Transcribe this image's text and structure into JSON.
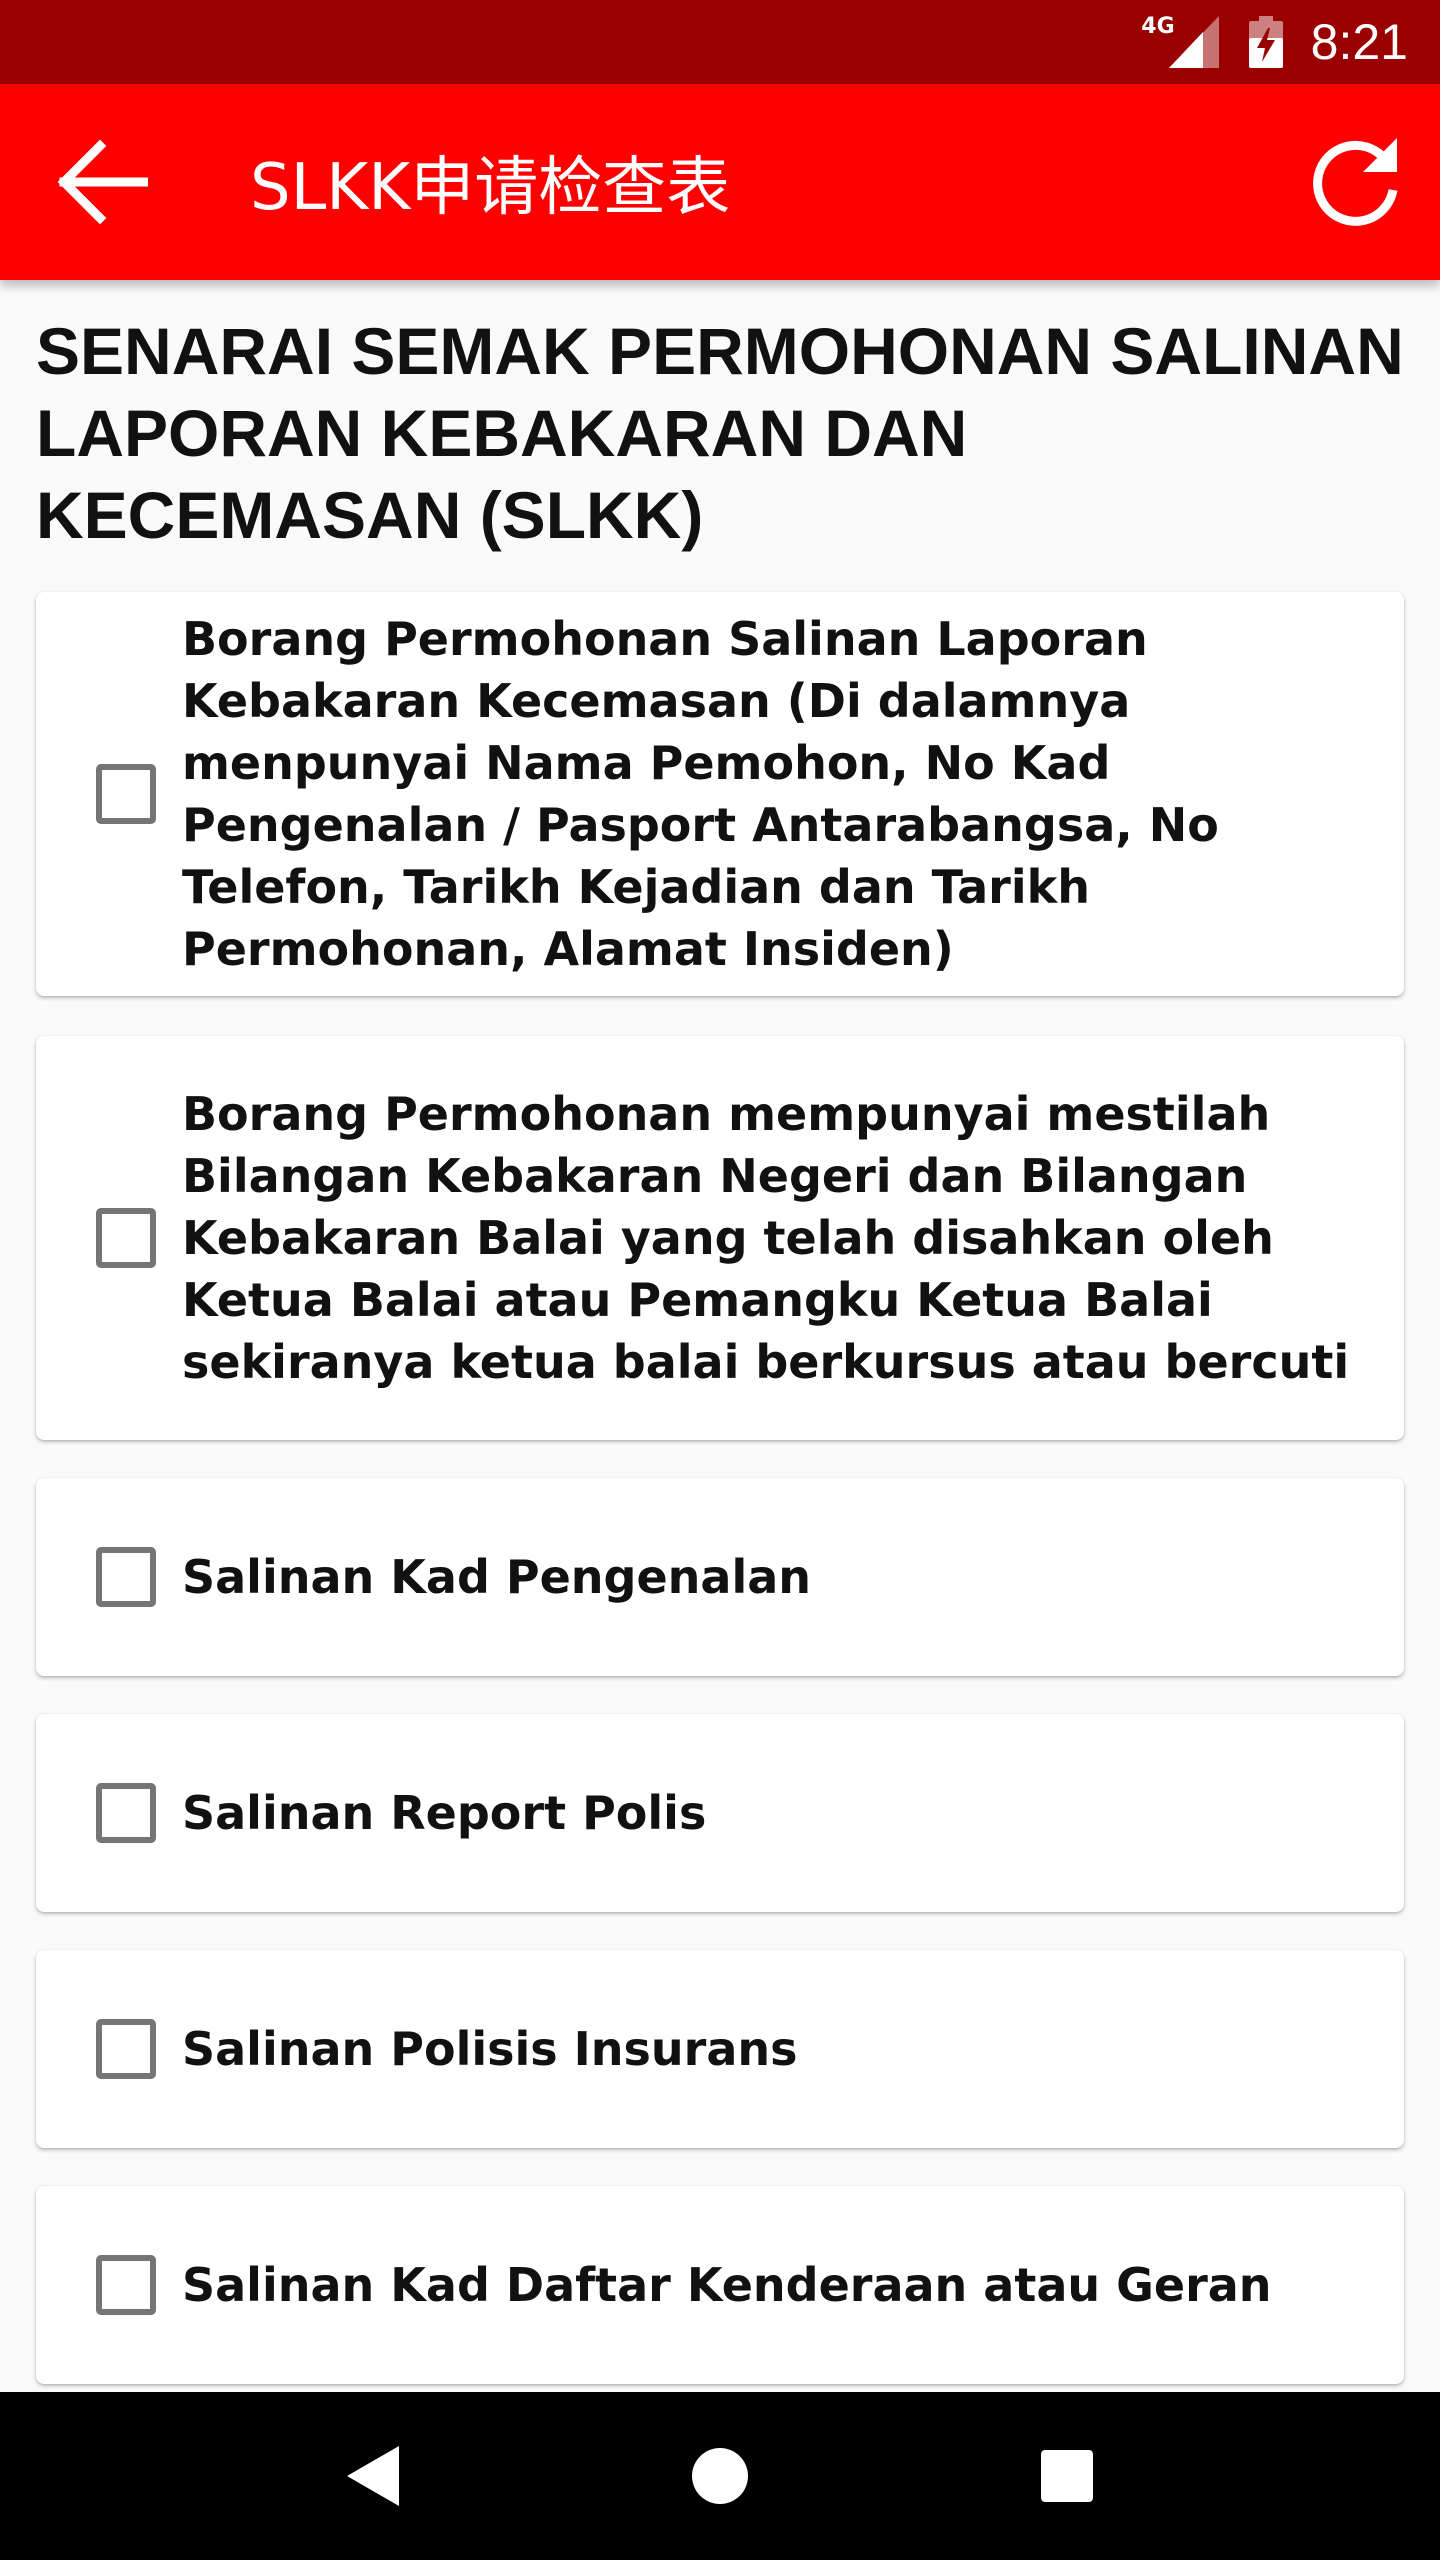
{
  "status_bar": {
    "network": "4G",
    "time": "8:21"
  },
  "app_bar": {
    "title": "SLKK申请检查表",
    "back_icon": "arrow-left-icon",
    "refresh_icon": "refresh-icon"
  },
  "main": {
    "heading": "SENARAI SEMAK PERMOHONAN SALINAN LAPORAN KEBAKARAN DAN KECEMASAN (SLKK)",
    "items": [
      {
        "label": "Borang Permohonan Salinan Laporan Kebakaran Kecemasan (Di dalamnya menpunyai Nama Pemohon, No Kad Pengenalan / Pasport Antarabangsa, No Telefon, Tarikh Kejadian dan Tarikh Permohonan, Alamat Insiden)",
        "checked": false
      },
      {
        "label": "Borang Permohonan mempunyai mestilah Bilangan Kebakaran Negeri dan Bilangan Kebakaran Balai yang telah disahkan oleh Ketua Balai atau Pemangku Ketua Balai sekiranya ketua balai berkursus atau bercuti",
        "checked": false
      },
      {
        "label": "Salinan Kad Pengenalan",
        "checked": false
      },
      {
        "label": "Salinan Report Polis",
        "checked": false
      },
      {
        "label": "Salinan Polisis Insurans",
        "checked": false
      },
      {
        "label": "Salinan Kad Daftar Kenderaan atau Geran",
        "checked": false
      }
    ]
  },
  "colors": {
    "status_bar": "#9b0000",
    "app_bar": "#ff0000",
    "checkbox_border": "#757575",
    "nav_bar": "#000000"
  },
  "nav_bar": {
    "back_icon": "triangle-back-icon",
    "home_icon": "circle-home-icon",
    "recents_icon": "square-recents-icon"
  }
}
